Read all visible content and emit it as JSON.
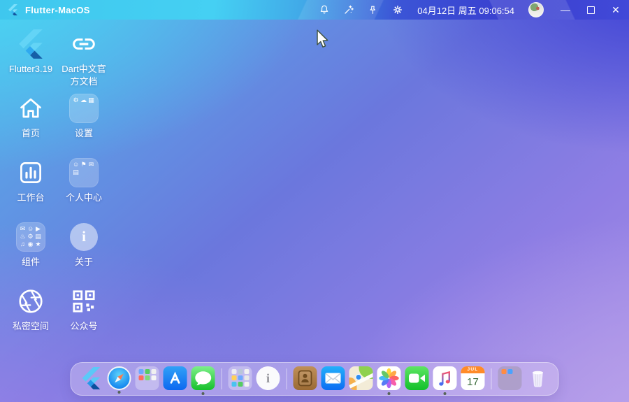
{
  "window": {
    "title": "Flutter-MacOS",
    "datetime": "04月12日 周五 09:06:54",
    "controls": {
      "minimize": "—",
      "close": "✕"
    }
  },
  "topbar": {
    "icons": [
      "bell",
      "magic-wand",
      "pin",
      "gear"
    ]
  },
  "desktop": {
    "items": [
      {
        "name": "flutter-version",
        "label": "Flutter3.19",
        "icon": "flutter-logo"
      },
      {
        "name": "dart-docs",
        "label": "Dart中文官方文档",
        "icon": "link-icon"
      },
      {
        "name": "home",
        "label": "首页",
        "icon": "home-icon"
      },
      {
        "name": "settings",
        "label": "设置",
        "icon": "settings-folder"
      },
      {
        "name": "workbench",
        "label": "工作台",
        "icon": "bar-chart-icon"
      },
      {
        "name": "profile-center",
        "label": "个人中心",
        "icon": "profile-folder"
      },
      {
        "name": "components",
        "label": "组件",
        "icon": "components-folder"
      },
      {
        "name": "about",
        "label": "关于",
        "icon": "info-icon",
        "glyph": "i"
      },
      {
        "name": "private-space",
        "label": "私密空间",
        "icon": "aperture-icon"
      },
      {
        "name": "official-account",
        "label": "公众号",
        "icon": "qr-code-icon"
      }
    ]
  },
  "dock": {
    "items": [
      {
        "name": "flutter"
      },
      {
        "name": "safari",
        "running": true
      },
      {
        "name": "apps-folder"
      },
      {
        "name": "app-store"
      },
      {
        "name": "messages",
        "running": true
      },
      {
        "name": "divider"
      },
      {
        "name": "launchpad"
      },
      {
        "name": "info",
        "glyph": "i"
      },
      {
        "name": "divider"
      },
      {
        "name": "contacts"
      },
      {
        "name": "mail"
      },
      {
        "name": "maps"
      },
      {
        "name": "photos",
        "running": true
      },
      {
        "name": "facetime"
      },
      {
        "name": "music",
        "running": true
      },
      {
        "name": "calendar",
        "month": "JUL",
        "day": "17"
      },
      {
        "name": "divider"
      },
      {
        "name": "misc-folder"
      },
      {
        "name": "trash"
      }
    ]
  },
  "colors": {
    "titlebar_left": "#41c8ee",
    "titlebar_right": "#3a41d0",
    "desktop_top_left": "#48d7f3",
    "desktop_top_right": "#4447d3",
    "desktop_bottom_left": "#9d83e9",
    "desktop_bottom_right": "#bba4e8",
    "dock_bg": "rgba(222,206,244,0.42)",
    "calendar_accent": "#ff8b29"
  }
}
